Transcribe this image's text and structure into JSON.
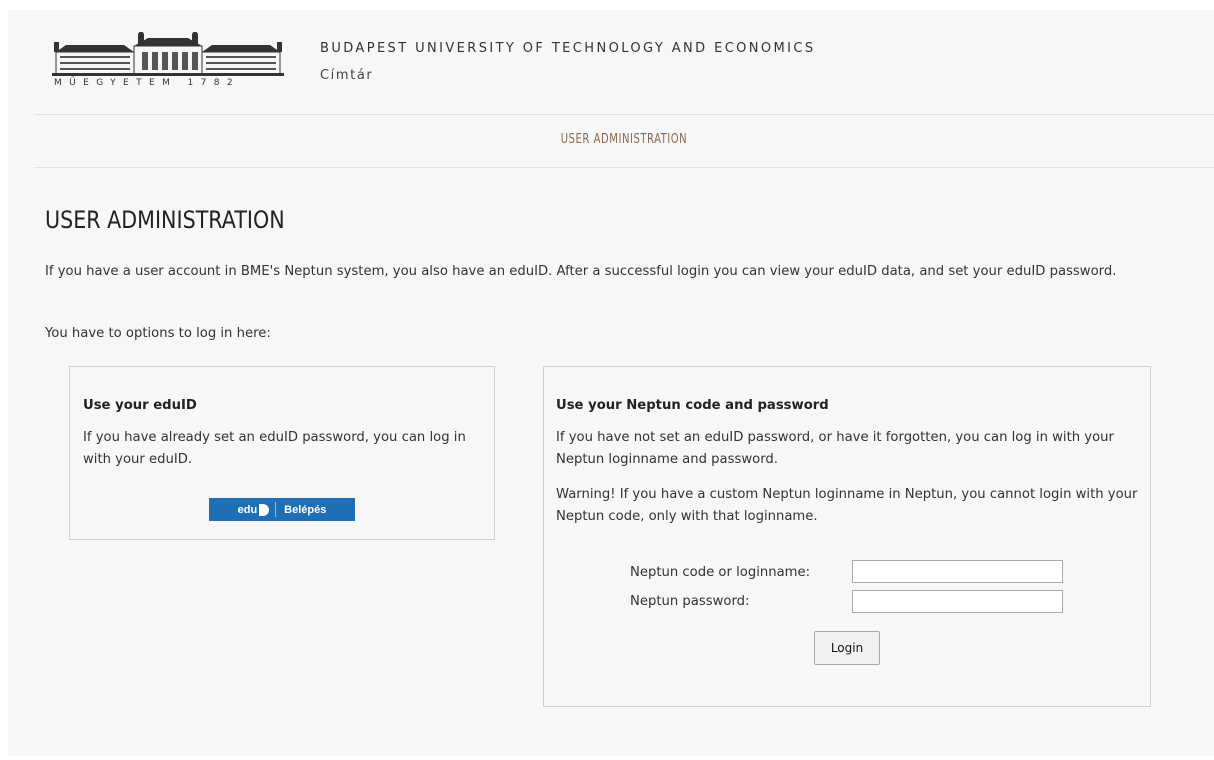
{
  "header": {
    "logo_text": "MŰEGYETEM 1782",
    "university_name": "BUDAPEST UNIVERSITY OF TECHNOLOGY AND ECONOMICS",
    "subtitle": "Címtár"
  },
  "nav": {
    "items": [
      {
        "label": "USER ADMINISTRATION"
      }
    ]
  },
  "main": {
    "title": "USER ADMINISTRATION",
    "intro": "If you have a user account in BME's Neptun system, you also have an eduID. After a successful login you can view your eduID data, and set your eduID password.",
    "options_text": "You have to options to log in here:"
  },
  "eduid_box": {
    "heading": "Use your eduID",
    "text": "If you have already set an eduID password, you can log in with your eduID.",
    "button_brand": "edu",
    "button_label": "Belépés"
  },
  "neptun_box": {
    "heading": "Use your Neptun code and password",
    "text": "If you have not set an eduID password, or have it forgotten, you can log in with your Neptun loginname and password.",
    "warning": "Warning! If you have a custom Neptun loginname in Neptun, you cannot login with your Neptun code, only with that loginname.",
    "username_label": "Neptun code or loginname:",
    "username_value": "",
    "password_label": "Neptun password:",
    "password_value": "",
    "login_label": "Login"
  },
  "colors": {
    "nav_text": "#8a6a4a",
    "eduid_button": "#1f6fb5",
    "page_background": "#f7f7f7"
  }
}
